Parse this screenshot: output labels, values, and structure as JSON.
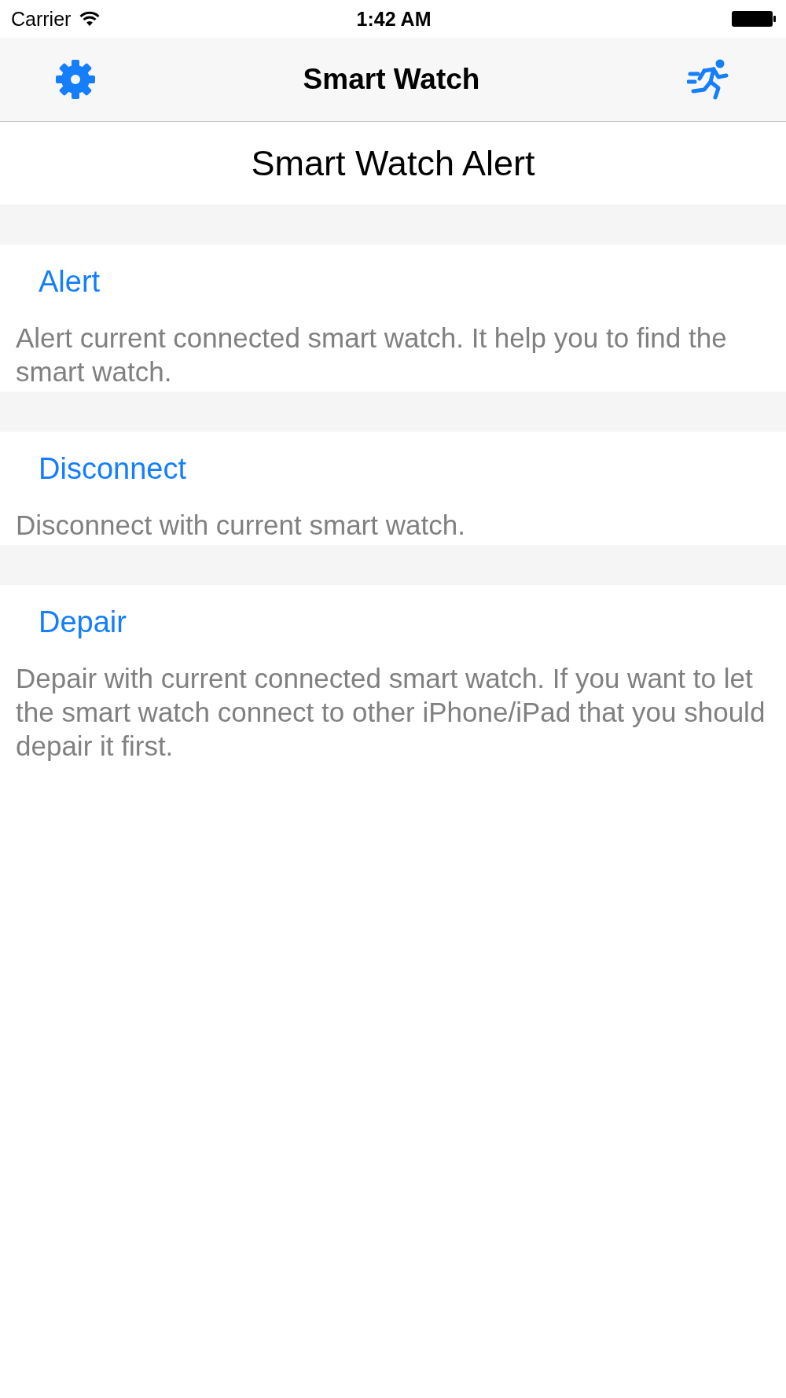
{
  "status_bar": {
    "carrier": "Carrier",
    "time": "1:42 AM"
  },
  "nav_bar": {
    "title": "Smart Watch"
  },
  "header": "Smart Watch Alert",
  "sections": [
    {
      "action": "Alert",
      "description": "Alert current connected smart watch. It help you to find the smart watch."
    },
    {
      "action": "Disconnect",
      "description": "Disconnect with current smart watch."
    },
    {
      "action": "Depair",
      "description": "Depair with current connected smart watch. If you want to let the smart watch connect to other iPhone/iPad that you should depair it first."
    }
  ]
}
